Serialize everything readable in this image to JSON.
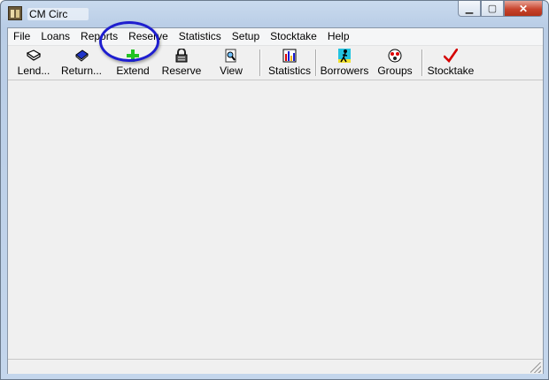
{
  "window": {
    "title": "CM Circ"
  },
  "menu": [
    "File",
    "Loans",
    "Reports",
    "Reserve",
    "Statistics",
    "Setup",
    "Stocktake",
    "Help"
  ],
  "toolbar": {
    "lend": "Lend...",
    "return": "Return...",
    "extend": "Extend",
    "reserve": "Reserve",
    "view": "View",
    "statistics": "Statistics",
    "borrowers": "Borrowers",
    "groups": "Groups",
    "stocktake": "Stocktake"
  },
  "icons": {
    "lend": "open-book-icon",
    "return": "closed-book-icon",
    "extend": "plus-icon",
    "reserve": "lock-icon",
    "view": "magnifier-icon",
    "statistics": "bar-chart-icon",
    "borrowers": "person-icon",
    "groups": "group-icon",
    "stocktake": "checkmark-icon"
  },
  "colors": {
    "highlight_ring": "#1e1ecf",
    "extend_icon": "#22c322",
    "stocktake_icon": "#d40000"
  }
}
